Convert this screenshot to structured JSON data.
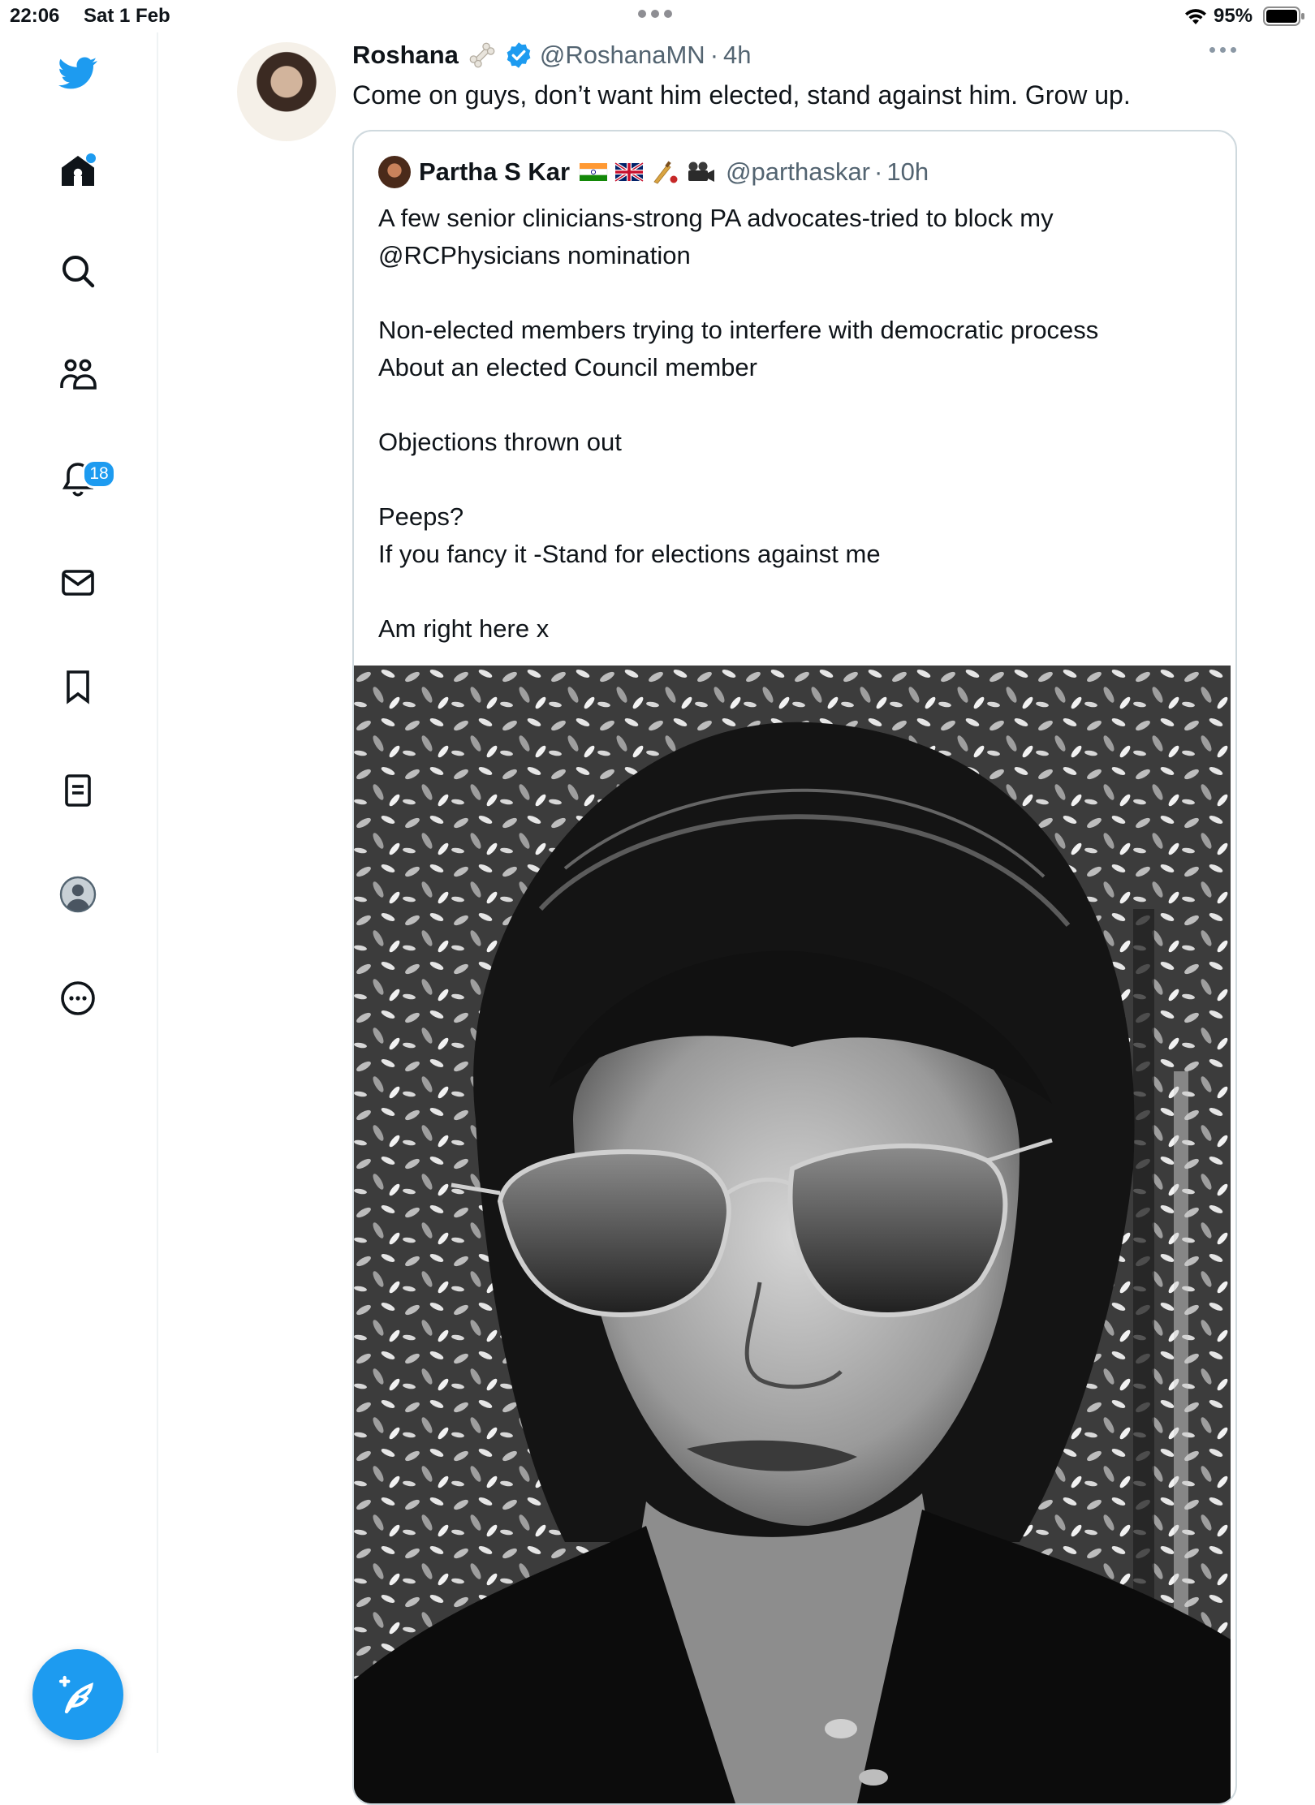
{
  "status_bar": {
    "time": "22:06",
    "date": "Sat 1 Feb",
    "battery": "95%"
  },
  "sidebar": {
    "items": [
      {
        "name": "home",
        "icon": "home-icon"
      },
      {
        "name": "explore",
        "icon": "search-icon"
      },
      {
        "name": "communities",
        "icon": "communities-icon"
      },
      {
        "name": "notifications",
        "icon": "bell-icon",
        "badge": "18"
      },
      {
        "name": "messages",
        "icon": "mail-icon"
      },
      {
        "name": "bookmarks",
        "icon": "bookmark-icon"
      },
      {
        "name": "lists",
        "icon": "list-icon"
      },
      {
        "name": "profile",
        "icon": "profile-icon"
      },
      {
        "name": "more",
        "icon": "more-circle-icon"
      }
    ],
    "compose_icon": "compose-feather-icon"
  },
  "tweet": {
    "author_name": "Roshana",
    "handle": "@RoshanaMN",
    "separator": "·",
    "time": "4h",
    "text": "Come on guys, don’t want him elected, stand against him. Grow up."
  },
  "quote": {
    "author_name": "Partha S Kar",
    "handle": "@parthaskar",
    "separator": "·",
    "time": "10h",
    "lines": [
      "A few senior clinicians-strong PA advocates-tried to block my",
      "@RCPhysicians nomination",
      "",
      "Non-elected members trying to interfere with  democratic process",
      "About an elected Council member",
      "",
      "Objections thrown out",
      "",
      "Peeps?",
      "If you fancy it -Stand for elections against me",
      "",
      "Am right here x"
    ]
  },
  "colors": {
    "accent": "#1d9bf0",
    "text": "#0f1419",
    "muted": "#536471",
    "border": "#cfd9de"
  }
}
